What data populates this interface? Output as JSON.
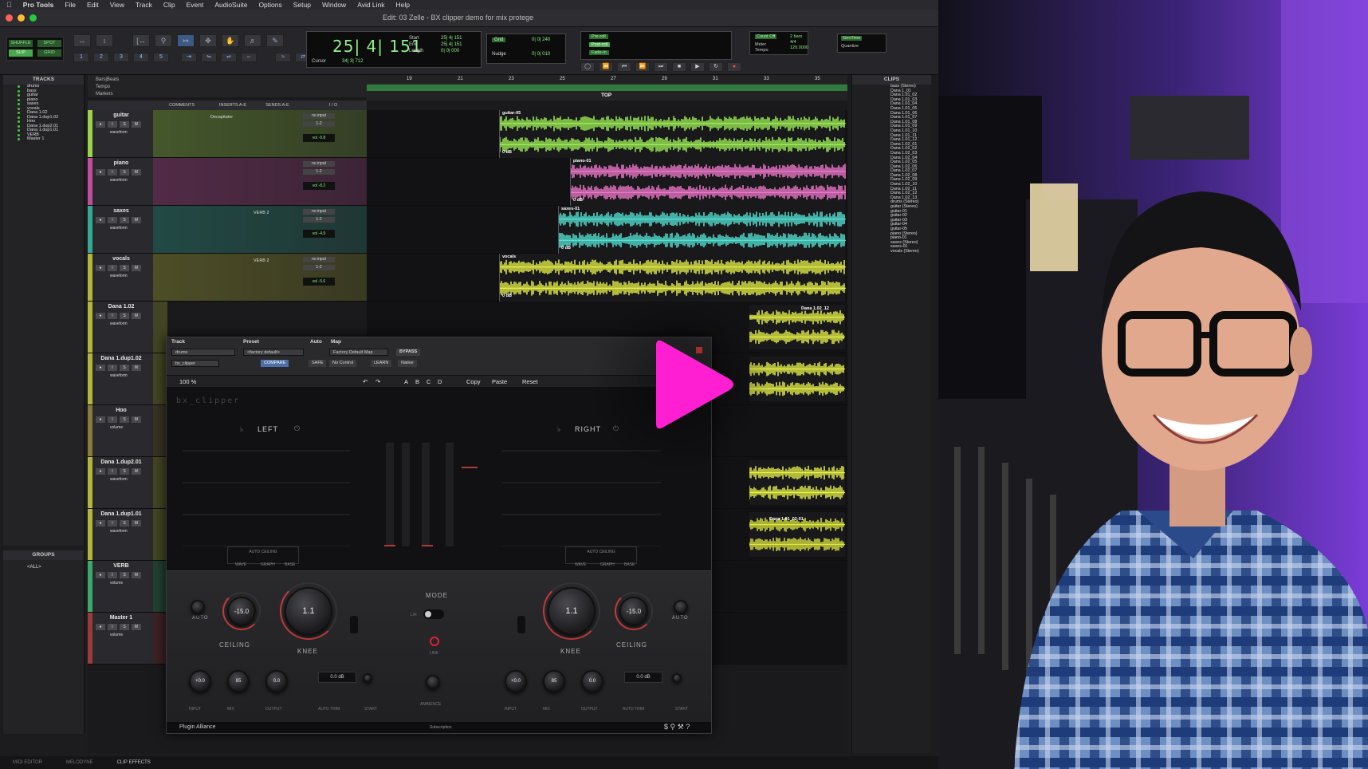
{
  "menubar": {
    "app_name": "Pro Tools",
    "items": [
      "File",
      "Edit",
      "View",
      "Track",
      "Clip",
      "Event",
      "AudioSuite",
      "Options",
      "Setup",
      "Window",
      "Avid Link",
      "Help"
    ]
  },
  "window": {
    "title": "Edit: 03 Zelle - BX clipper demo for mix protege"
  },
  "toolbar": {
    "modes": [
      "SHUFFLE",
      "SPOT",
      "SLIP",
      "GRID"
    ],
    "grid_numbers": [
      "1",
      "2",
      "3",
      "4",
      "5"
    ],
    "main_counter": "25| 4| 151",
    "counter_labels": [
      "Start",
      "End",
      "Length"
    ],
    "counter_values": [
      "25| 4| 151",
      "25| 4| 151",
      "0| 0| 000"
    ],
    "cursor_label": "Cursor",
    "cursor_value": "34| 3| 712",
    "grid_label": "Grid",
    "grid_value": "0| 0| 240",
    "nudge_label": "Nudge",
    "nudge_value": "0| 0| 010",
    "preroll": [
      "Pre-roll",
      "Post-roll",
      "Fade-in"
    ],
    "count_off": "Count Off",
    "meter": "Meter",
    "tempo": "Tempo",
    "count_off_values": [
      "2 bars",
      "4/4",
      "120.0000"
    ],
    "quantize": "Quantize",
    "quantize_label": "Link",
    "timecode": "GenTime",
    "transport_icons": [
      "online",
      "rewind",
      "fast-forward",
      "go-to-start",
      "go-to-end",
      "stop",
      "play",
      "loop",
      "record"
    ]
  },
  "tracks_panel": {
    "title": "TRACKS",
    "items": [
      "drums",
      "bass",
      "guitar",
      "piano",
      "saxes",
      "vocals",
      "Dana 1.02",
      "Dana 1.dup1.02",
      "Hoo",
      "Dana 1.dup2.01",
      "Dana 1.dup1.01",
      "VERB",
      "Master 1"
    ]
  },
  "groups_panel": {
    "title": "GROUPS",
    "all": "<ALL>"
  },
  "ruler": {
    "labels": [
      "Bars|Beats",
      "Tempo",
      "Markers"
    ],
    "bars": [
      "19",
      "21",
      "23",
      "25",
      "27",
      "29",
      "31",
      "33",
      "35"
    ],
    "marker": "TOP"
  },
  "columns": [
    "COMMENTS",
    "INSERTS A-E",
    "SENDS A-E",
    "I / O"
  ],
  "tracks": [
    {
      "name": "guitar",
      "color": "#9bd24a",
      "insert": "Decapitator",
      "send": "",
      "io_in": "no input",
      "io_out": "1-2",
      "vol": "vol  -9.8",
      "view": "waveform",
      "clip": "guitar-05",
      "db": "0 dB",
      "wave": "#a8ff5a"
    },
    {
      "name": "piano",
      "color": "#c24d9c",
      "insert": "",
      "send": "",
      "io_in": "no input",
      "io_out": "1-2",
      "vol": "vol  -8.2",
      "view": "waveform",
      "clip": "piano-01",
      "db": "0 dB",
      "wave": "#ff7fd8"
    },
    {
      "name": "saxes",
      "color": "#33a995",
      "insert": "",
      "send": "VERB 2",
      "io_in": "no input",
      "io_out": "1-2",
      "vol": "vol  -4.9",
      "view": "waveform",
      "clip": "saxes-01",
      "db": "0 dB",
      "wave": "#57f0e0"
    },
    {
      "name": "vocals",
      "color": "#b4b63c",
      "insert": "",
      "send": "VERB 2",
      "io_in": "no input",
      "io_out": "1-2",
      "vol": "vol  -5.6",
      "view": "waveform",
      "clip": "vocals",
      "db": "0 dB",
      "wave": "#f4ff4a"
    }
  ],
  "lower_tracks": [
    {
      "name": "Dana 1.02",
      "view": "waveform"
    },
    {
      "name": "Dana 1.dup1.02",
      "view": "waveform"
    },
    {
      "name": "Hoo",
      "view": "volume"
    },
    {
      "name": "Dana 1.dup2.01",
      "view": "waveform"
    },
    {
      "name": "Dana 1.dup1.01",
      "view": "waveform"
    },
    {
      "name": "VERB",
      "view": "volume"
    },
    {
      "name": "Master 1",
      "view": "volume"
    }
  ],
  "lower_clips": [
    "Dana 1.02_12",
    "Dana 1.01_02-01"
  ],
  "plugin": {
    "track_label": "Track",
    "preset_label": "Preset",
    "auto_label": "Auto",
    "map_label": "Map",
    "track_value": "drums",
    "plugin_value": "bx_clipper",
    "preset_value": "<factory default>",
    "auto_value": "Factory Default Map",
    "bypass": "BYPASS",
    "compare": "COMPARE",
    "safe": "SAFE",
    "no_control": "No Control",
    "learn": "LEARN",
    "native": "Native",
    "zoom": "100 %",
    "ab": [
      "A",
      "B",
      "C",
      "D"
    ],
    "copy": "Copy",
    "paste": "Paste",
    "reset": "Reset",
    "brand": "bx_clipper",
    "left": "LEFT",
    "right": "RIGHT",
    "auto_ceiling_left": "AUTO CEILING",
    "auto_ceiling_right": "AUTO CEILING",
    "mode_lbls": [
      "WAVE",
      "GRAPH",
      "BASE"
    ],
    "mode": "MODE",
    "lr": "L/R",
    "link": "LINK",
    "ambience": "AMBIENCE",
    "knee": "KNEE",
    "ceiling": "CEILING",
    "knee_value": "1.1",
    "ceiling_value": "-15.0",
    "auto_lbl": "AUTO",
    "small_knobs": [
      "INPUT",
      "MIX",
      "OUTPUT"
    ],
    "small_vals": [
      "+0.0",
      "85",
      "0.0"
    ],
    "auto_trim": "AUTO TRIM",
    "start": "START",
    "trim_value": "0.0 dB",
    "footer_brand": "Plugin Alliance",
    "footer_sub": "Subscription"
  },
  "clips_panel": {
    "title": "CLIPS",
    "items": [
      "bass (Stereo)",
      "Dana 1_01",
      "Dana 1.01_02",
      "Dana 1.01_03",
      "Dana 1.01_04",
      "Dana 1.01_05",
      "Dana 1.01_06",
      "Dana 1.01_07",
      "Dana 1.01_08",
      "Dana 1.01_09",
      "Dana 1.01_10",
      "Dana 1.01_11",
      "Dana 1.01_12",
      "Dana 1.02_01",
      "Dana 1.02_02",
      "Dana 1.02_03",
      "Dana 1.02_04",
      "Dana 1.02_05",
      "Dana 1.02_06",
      "Dana 1.02_07",
      "Dana 1.02_08",
      "Dana 1.02_09",
      "Dana 1.02_10",
      "Dana 1.02_11",
      "Dana 1.02_12",
      "Dana 1.02_13",
      "drums (Stereo)",
      "guitar (Stereo)",
      "guitar-01",
      "guitar-02",
      "guitar-03",
      "guitar-04",
      "guitar-05",
      "piano (Stereo)",
      "piano-01",
      "saxes (Stereo)",
      "saxes-01",
      "vocals (Stereo)"
    ]
  },
  "bottom_tabs": [
    "MIDI EDITOR",
    "MELODYNE",
    "CLIP EFFECTS"
  ],
  "overlay": {
    "play_color": "#ff1fd2",
    "icon": "play-icon"
  }
}
